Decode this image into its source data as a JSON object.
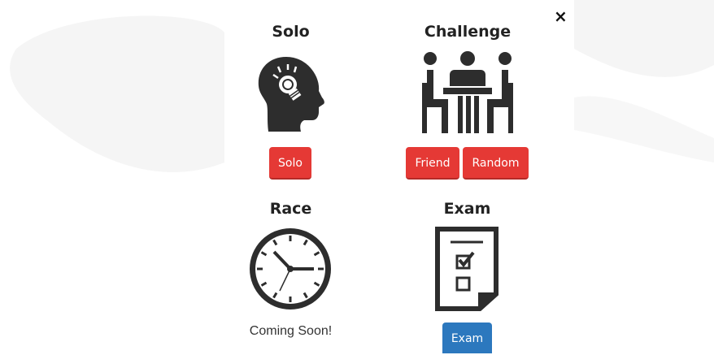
{
  "modal": {
    "close_label": "×"
  },
  "solo": {
    "title": "Solo",
    "button_label": "Solo",
    "icon": "head-lightbulb-icon"
  },
  "challenge": {
    "title": "Challenge",
    "friend_label": "Friend",
    "random_label": "Random",
    "icon": "people-at-table-icon"
  },
  "race": {
    "title": "Race",
    "status": "Coming Soon!",
    "icon": "clock-icon"
  },
  "exam": {
    "title": "Exam",
    "button_label": "Exam",
    "icon": "checklist-document-icon"
  },
  "colors": {
    "red_button": "#e53935",
    "blue_button": "#2c78be",
    "background_shape": "#f4f4f4"
  }
}
